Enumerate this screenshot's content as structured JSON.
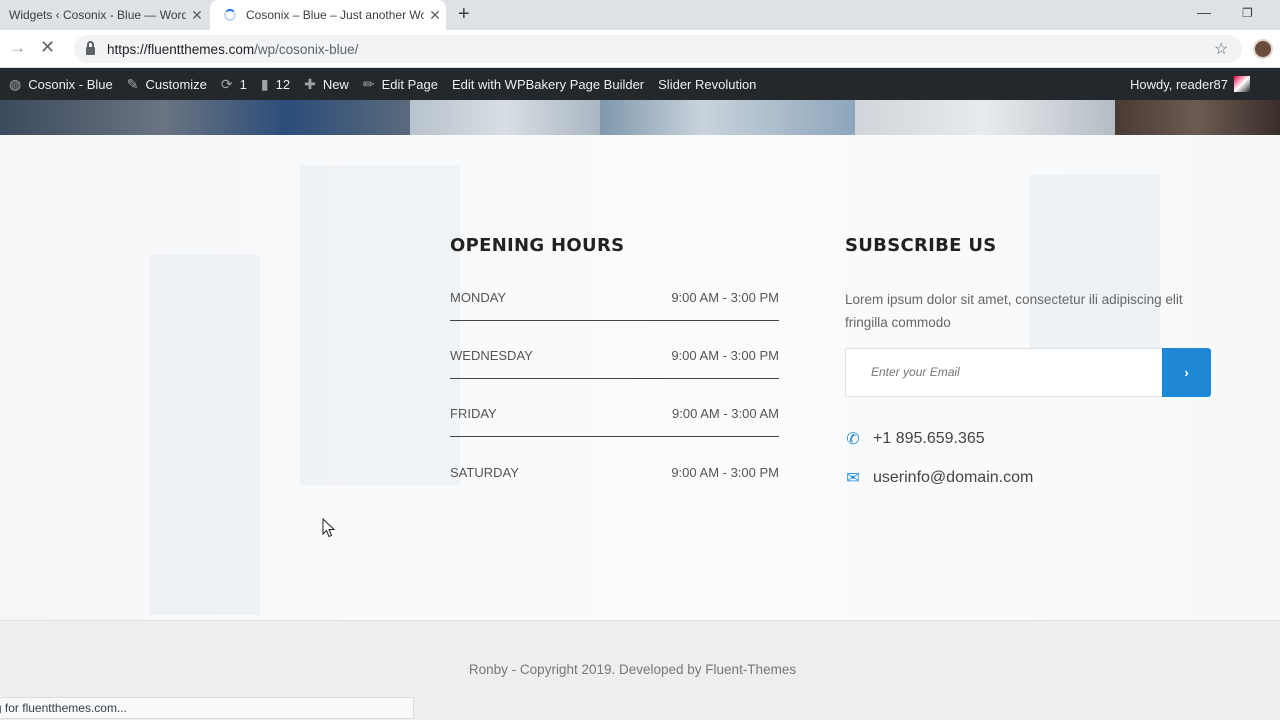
{
  "browser": {
    "tabs": [
      {
        "title": "Widgets ‹ Cosonix - Blue — WordPress",
        "active": false
      },
      {
        "title": "Cosonix – Blue – Just another WordPress site",
        "active": true
      }
    ],
    "new_tab_icon": "plus-icon",
    "url_host": "https://fluentthemes.com",
    "url_path": "/wp/cosonix-blue/",
    "status_text": "Waiting for fluentthemes.com..."
  },
  "admin_bar": {
    "site_name": "Cosonix - Blue",
    "customize": "Customize",
    "updates_count": "1",
    "comments_count": "12",
    "new": "New",
    "edit_page": "Edit Page",
    "wpbakery": "Edit with WPBakery Page Builder",
    "slider": "Slider Revolution",
    "howdy": "Howdy, reader87"
  },
  "opening_hours": {
    "title": "OPENING HOURS",
    "rows": [
      {
        "day": "MONDAY",
        "time": "9:00 AM - 3:00 PM"
      },
      {
        "day": "WEDNESDAY",
        "time": "9:00 AM - 3:00 PM"
      },
      {
        "day": "FRIDAY",
        "time": "9:00 AM - 3:00 AM"
      },
      {
        "day": "SATURDAY",
        "time": "9:00 AM - 3:00 PM"
      }
    ]
  },
  "subscribe": {
    "title": "SUBSCRIBE US",
    "text": "Lorem ipsum dolor sit amet, consectetur ili adipiscing elit fringilla commodo",
    "email_placeholder": "Enter your Email",
    "submit_icon": "chevron-right-icon",
    "phone": "+1 895.659.365",
    "email": "userinfo@domain.com"
  },
  "footer": {
    "copyright": "Ronby - Copyright 2019. Developed by Fluent-Themes"
  },
  "colors": {
    "accent": "#1e88d6",
    "admin_bar": "#23282d"
  }
}
